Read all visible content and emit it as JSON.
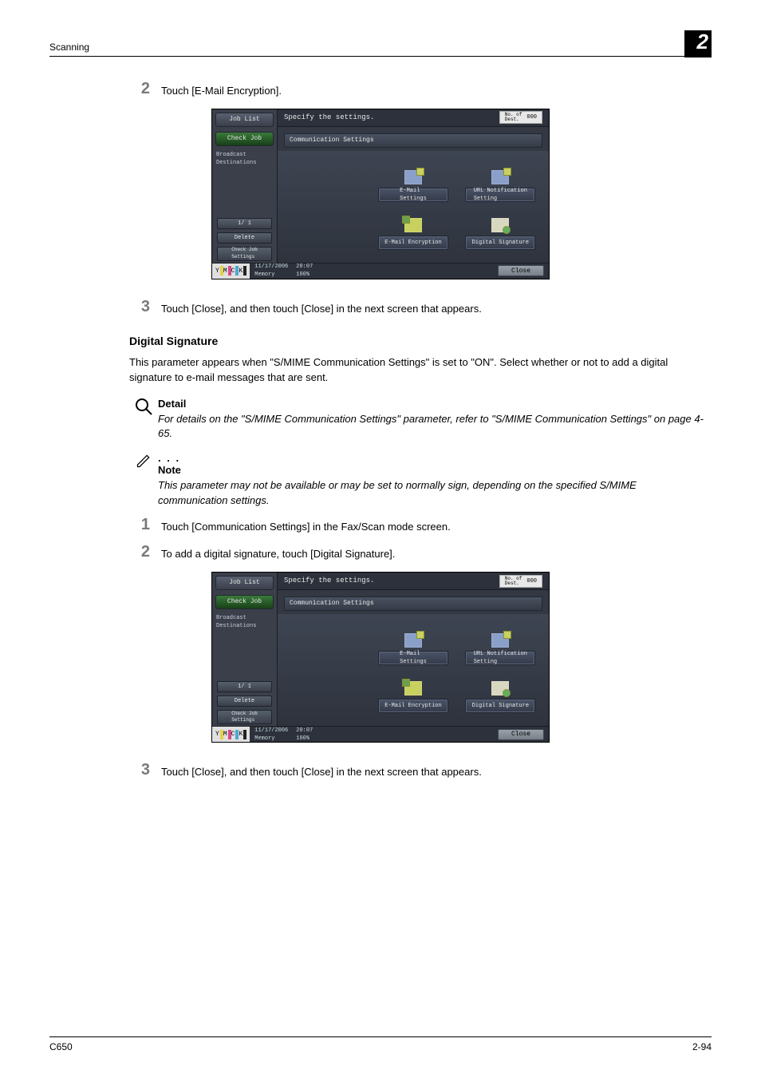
{
  "header": {
    "section": "Scanning",
    "pageno": "2"
  },
  "footer": {
    "model": "C650",
    "page": "2-94"
  },
  "steps_a": {
    "s2": {
      "num": "2",
      "txt": "Touch [E-Mail Encryption]."
    },
    "s3": {
      "num": "3",
      "txt": "Touch [Close], and then touch [Close] in the next screen that appears."
    }
  },
  "digsig": {
    "heading": "Digital Signature",
    "para": "This parameter appears when \"S/MIME Communication Settings\" is set to \"ON\". Select whether or not to add a digital signature to e-mail messages that are sent."
  },
  "detail": {
    "head": "Detail",
    "txt": "For details on the \"S/MIME Communication Settings\" parameter, refer to \"S/MIME Communication Settings\" on page 4-65."
  },
  "note": {
    "dots": ". . .",
    "head": "Note",
    "txt": "This parameter may not be available or may be set to normally sign, depending on the specified S/MIME communication settings."
  },
  "steps_b": {
    "s1": {
      "num": "1",
      "txt": "Touch [Communication Settings] in the Fax/Scan mode screen."
    },
    "s2": {
      "num": "2",
      "txt": "To add a digital signature, touch [Digital Signature]."
    },
    "s3": {
      "num": "3",
      "txt": "Touch [Close], and then touch [Close] in the next screen that appears."
    }
  },
  "shot": {
    "title": "Specify the settings.",
    "badge": {
      "a": "No. of\nDest.",
      "b": "000"
    },
    "side": {
      "tab1": "Job List",
      "tab2": "Check Job",
      "label": "Broadcast\nDestinations",
      "pager": "1/  1",
      "delete": "Delete",
      "checkjob": "Check Job\nSettings"
    },
    "subhead": "Communication Settings",
    "buttons": {
      "email": "E-Mail\nSettings",
      "url": "URL Notification\nSetting",
      "enc": "E-Mail Encryption",
      "sig": "Digital Signature"
    },
    "foot": {
      "date": "11/17/2006",
      "time": "20:07",
      "mem_l": "Memory",
      "mem_v": "100%",
      "close": "Close"
    },
    "ymck": {
      "y": "Y",
      "m": "M",
      "c": "C",
      "k": "K"
    }
  }
}
